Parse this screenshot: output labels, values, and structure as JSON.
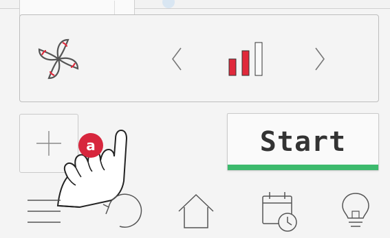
{
  "top": {
    "card_icon": "card-icon"
  },
  "fan": {
    "icon": "fan-icon",
    "level": 2,
    "max_level": 3,
    "active_color": "#e0293b",
    "prev_icon": "chevron-left-icon",
    "next_icon": "chevron-right-icon"
  },
  "actions": {
    "add_icon": "plus-icon",
    "start_label": "Start",
    "start_accent": "#3cba6d"
  },
  "annotation": {
    "marker": "a",
    "marker_color": "#d7263d"
  },
  "nav": {
    "items": [
      {
        "icon": "menu-icon"
      },
      {
        "icon": "undo-icon"
      },
      {
        "icon": "home-icon"
      },
      {
        "icon": "timer-icon"
      },
      {
        "icon": "lightbulb-icon"
      }
    ]
  }
}
